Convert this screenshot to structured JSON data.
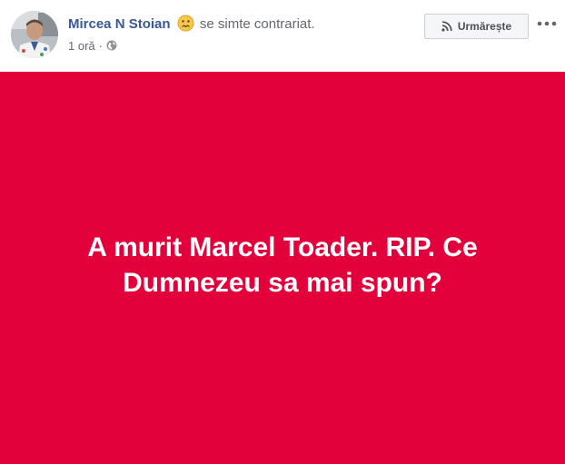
{
  "post": {
    "author": "Mircea N Stoian",
    "feeling_icon": "confused-face-icon",
    "feeling_text": "se simte contrariat.",
    "time": "1 oră",
    "separator": "·",
    "audience_icon": "globe-icon",
    "follow_icon": "rss-icon",
    "follow_label": "Urmărește",
    "more_icon": "more-horizontal-icon",
    "text": "A murit Marcel Toader. RIP. Ce Dumnezeu sa mai spun?"
  },
  "colors": {
    "background_color": "#e2013b",
    "text_color": "#ffffff",
    "name_color": "#385898"
  }
}
